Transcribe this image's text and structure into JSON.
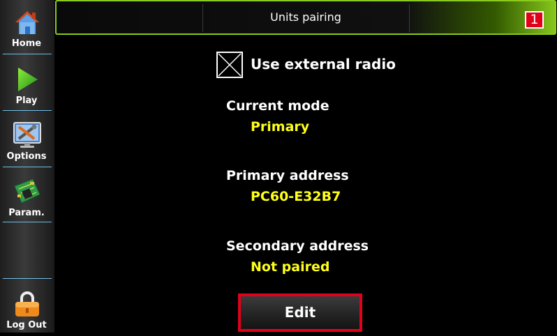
{
  "sidebar": {
    "items": [
      {
        "label": "Home",
        "icon": "home-icon"
      },
      {
        "label": "Play",
        "icon": "play-icon"
      },
      {
        "label": "Options",
        "icon": "tools-icon"
      },
      {
        "label": "Param.",
        "icon": "circuit-board-icon"
      },
      {
        "label": "Log Out",
        "icon": "lock-icon"
      }
    ]
  },
  "header": {
    "title": "Units pairing",
    "badge": "1",
    "accent_color": "#8acb1e",
    "badge_color": "#e0001a"
  },
  "main": {
    "external_radio": {
      "label": "Use external radio",
      "checked": true
    },
    "current_mode": {
      "label": "Current mode",
      "value": "Primary"
    },
    "primary_address": {
      "label": "Primary address",
      "value": "PC60-E32B7"
    },
    "secondary_address": {
      "label": "Secondary address",
      "value": "Not paired"
    },
    "edit_label": "Edit",
    "value_color": "#ffff1a"
  }
}
